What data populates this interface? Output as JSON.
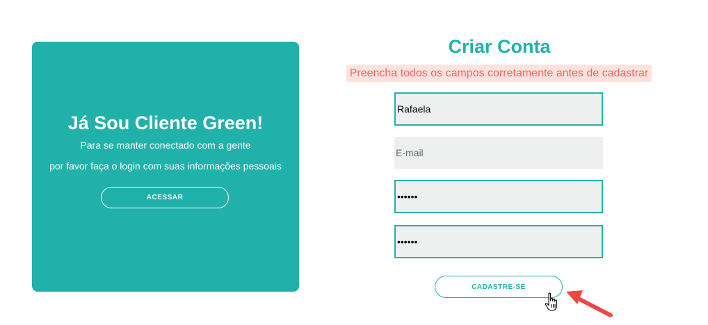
{
  "login_panel": {
    "title": "Já Sou Cliente Green!",
    "line1": "Para se manter conectado com a gente",
    "line2": "por favor faça o login com suas informações pessoais",
    "button_label": "ACESSAR"
  },
  "signup": {
    "title": "Criar Conta",
    "error": "Preencha todos os campos corretamente antes de cadastrar",
    "name_value": "Rafaela",
    "email_placeholder": "E-mail",
    "password_value": "••••••",
    "confirm_value": "••••••",
    "button_label": "CADASTRE-SE"
  },
  "colors": {
    "accent": "#20b2aa",
    "error_bg": "#fde2df",
    "error_text": "#f06a5a",
    "annotation_arrow": "#f04545"
  },
  "icons": {
    "cursor": "hand-pointer-cursor-icon",
    "annotation": "red-arrow-icon"
  }
}
